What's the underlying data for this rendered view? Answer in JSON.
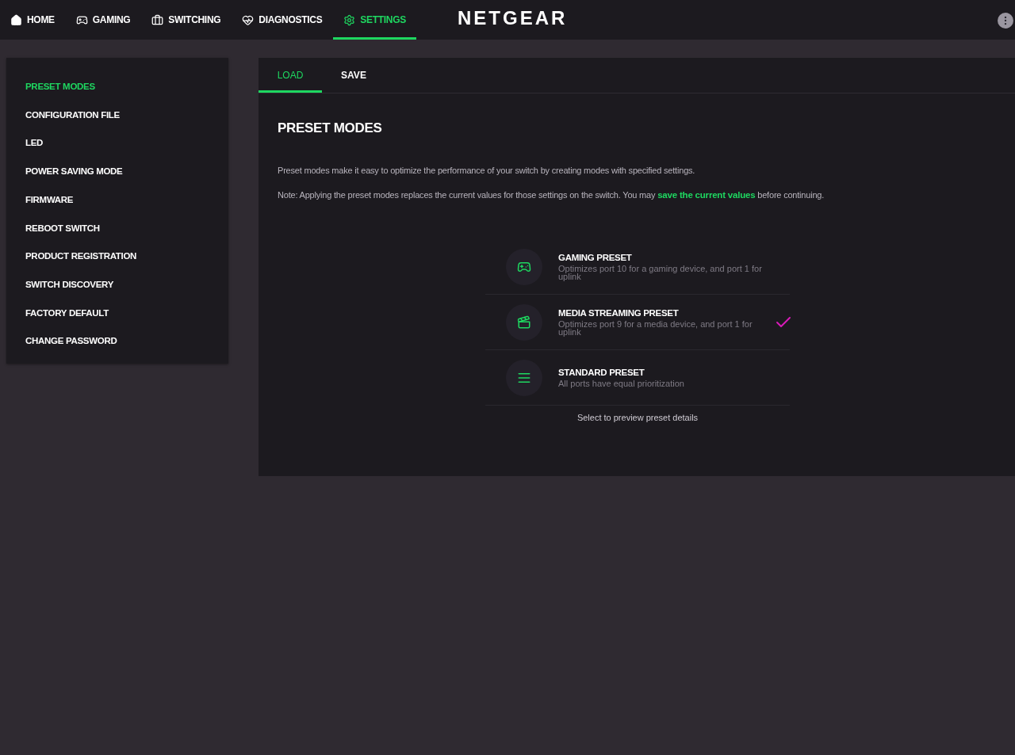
{
  "nav": {
    "items": [
      {
        "label": "HOME",
        "kind": "home",
        "selected": false
      },
      {
        "label": "GAMING",
        "kind": "gaming",
        "selected": false
      },
      {
        "label": "SWITCHING",
        "kind": "switching",
        "selected": false
      },
      {
        "label": "DIAGNOSTICS",
        "kind": "diagnostics",
        "selected": false
      },
      {
        "label": "SETTINGS",
        "kind": "settings",
        "selected": true
      }
    ],
    "logo": "NETGEAR"
  },
  "sidebar": {
    "items": [
      {
        "label": "PRESET MODES",
        "selected": true
      },
      {
        "label": "CONFIGURATION FILE",
        "selected": false
      },
      {
        "label": "LED",
        "selected": false
      },
      {
        "label": "POWER SAVING MODE",
        "selected": false
      },
      {
        "label": "FIRMWARE",
        "selected": false
      },
      {
        "label": "REBOOT SWITCH",
        "selected": false
      },
      {
        "label": "PRODUCT REGISTRATION",
        "selected": false
      },
      {
        "label": "SWITCH DISCOVERY",
        "selected": false
      },
      {
        "label": "FACTORY DEFAULT",
        "selected": false
      },
      {
        "label": "CHANGE PASSWORD",
        "selected": false
      }
    ]
  },
  "tabs": [
    {
      "label": "LOAD",
      "selected": true
    },
    {
      "label": "SAVE",
      "selected": false
    }
  ],
  "title": "PRESET MODES",
  "intro": "Preset modes make it easy to optimize the performance of your switch by creating modes with specified settings.",
  "note": {
    "before": "Note: Applying the preset modes replaces the current values for those settings on the switch. You may",
    "link": "save the current values",
    "after": "before continuing."
  },
  "presets": [
    {
      "kind": "gaming",
      "name": "GAMING PRESET",
      "description": "Optimizes port 10 for a gaming device, and port 1 for uplink",
      "selected": false
    },
    {
      "kind": "media",
      "name": "MEDIA STREAMING PRESET",
      "description": "Optimizes port 9 for a media device, and port 1 for uplink",
      "selected": true
    },
    {
      "kind": "standard",
      "name": "STANDARD PRESET",
      "description": "All ports have equal prioritization",
      "selected": false
    }
  ],
  "hint": "Select to preview preset details"
}
